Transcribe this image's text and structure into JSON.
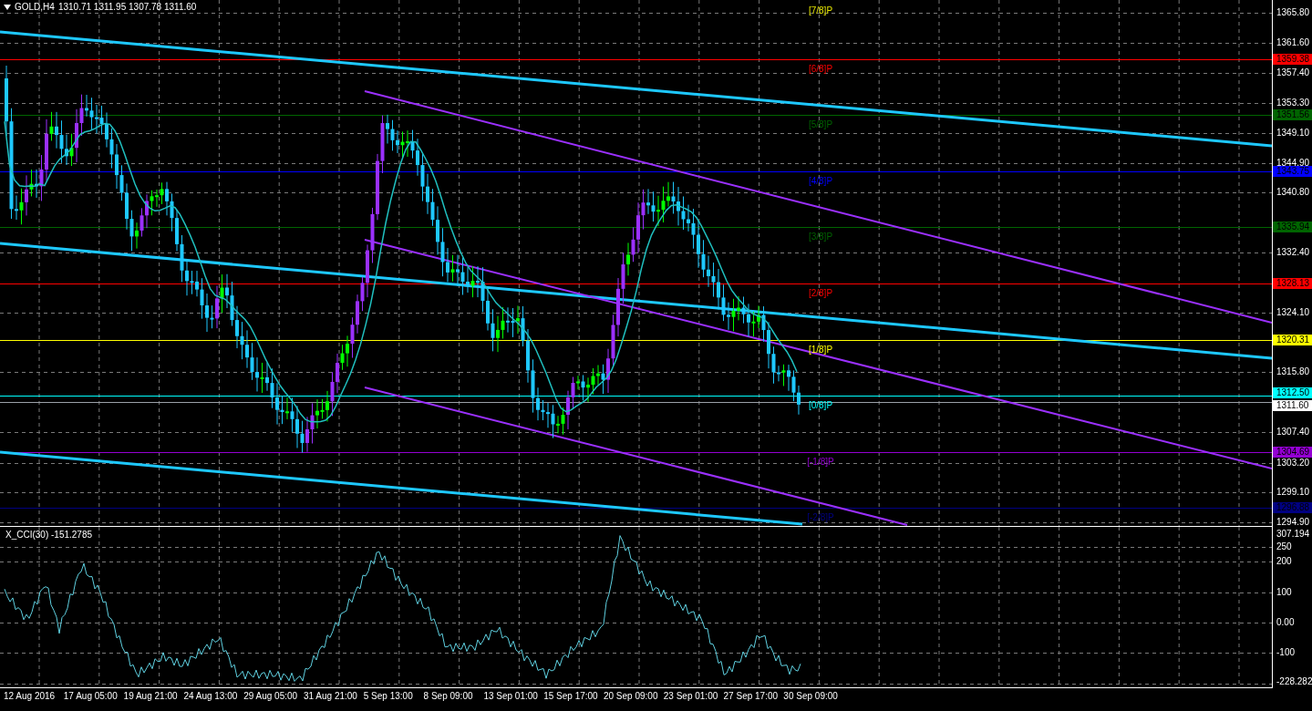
{
  "chart_header": {
    "symbol": "GOLD,H4",
    "ohlc": "1310.71 1311.95 1307.78 1311.60"
  },
  "murrey_levels": [
    {
      "label": "[7/8]P",
      "color": "#e6e600"
    },
    {
      "label": "[6/8]P",
      "color": "#ff0000",
      "price": "1359.38"
    },
    {
      "label": "[5/8]P",
      "color": "#006400",
      "price": "1351.56"
    },
    {
      "label": "[4/8]P",
      "color": "#0000ff",
      "price": "1343.75"
    },
    {
      "label": "[3/8]P",
      "color": "#006400",
      "price": "1335.94"
    },
    {
      "label": "[2/8]P",
      "color": "#ff0000",
      "price": "1328.13"
    },
    {
      "label": "[1/8]P",
      "color": "#ffff00",
      "price": "1320.31"
    },
    {
      "label": "[0/8]P",
      "color": "#00ffff",
      "price": "1312.50"
    },
    {
      "label": "[-1/8]P",
      "color": "#9400d3",
      "price": "1304.69"
    },
    {
      "label": "[-2/8]P",
      "color": "#000080",
      "price": "1296.88"
    }
  ],
  "current_price": "1311.60",
  "price_axis": [
    "1365.80",
    "1361.60",
    "1357.40",
    "1353.30",
    "1349.10",
    "1344.90",
    "1340.80",
    "1332.40",
    "1324.10",
    "1315.80",
    "1307.40",
    "1303.20",
    "1299.10",
    "1294.90"
  ],
  "indicator": {
    "title": "X_CCI(30) -151.2785",
    "axis": [
      "307.194",
      "250",
      "200",
      "100",
      "0.00",
      "-100",
      "-228.282"
    ]
  },
  "time_axis": [
    "12 Aug 2016",
    "17 Aug 05:00",
    "19 Aug 21:00",
    "24 Aug 13:00",
    "29 Aug 05:00",
    "31 Aug 21:00",
    "5 Sep 13:00",
    "8 Sep 09:00",
    "13 Sep 01:00",
    "15 Sep 17:00",
    "20 Sep 09:00",
    "23 Sep 01:00",
    "27 Sep 17:00",
    "30 Sep 09:00"
  ]
}
